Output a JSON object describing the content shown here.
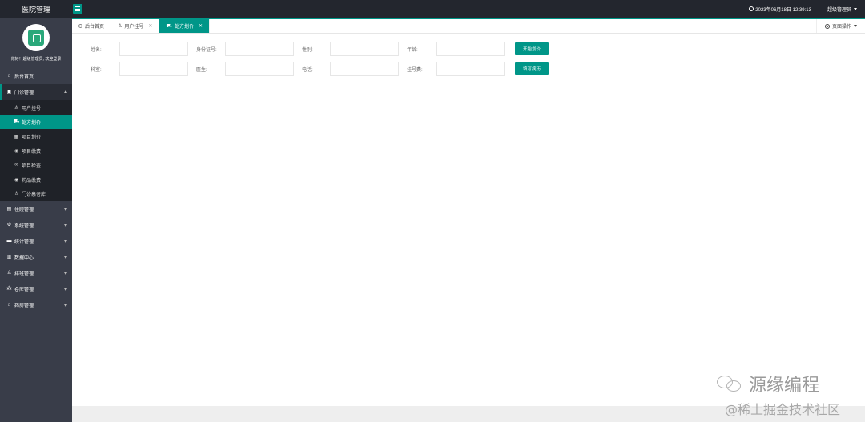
{
  "header": {
    "brand": "医院管理",
    "datetime": "2023年06月18日 12:39:13",
    "user": "超级管理员"
  },
  "sidebar": {
    "welcome": "你好！超级管理员, 欢迎登录",
    "home": "后台首页",
    "outpatient": "门诊管理",
    "outpatient_items": [
      "用户挂号",
      "处方划价",
      "项目划价",
      "项目缴费",
      "项目检查",
      "药品缴费",
      "门诊患者库"
    ],
    "groups": [
      "住院管理",
      "系统管理",
      "统计管理",
      "数据中心",
      "排班管理",
      "仓库管理",
      "药房管理"
    ]
  },
  "tabs": {
    "home": "后台首页",
    "register": "用户挂号",
    "prescription": "处方划价",
    "page_ops": "页面操作"
  },
  "form": {
    "row1": {
      "name": "姓名:",
      "idcard": "身份证号:",
      "gender": "性别:",
      "age": "年龄:",
      "button": "开始划价"
    },
    "row2": {
      "dept": "科室:",
      "doctor": "医生:",
      "phone": "电话:",
      "fee": "挂号费:",
      "button": "填写病历"
    }
  },
  "watermark": {
    "line1": "源缘编程",
    "line2": "@稀土掘金技术社区"
  },
  "colors": {
    "accent": "#009688",
    "sidebar": "#393d49",
    "header": "#23262e"
  }
}
